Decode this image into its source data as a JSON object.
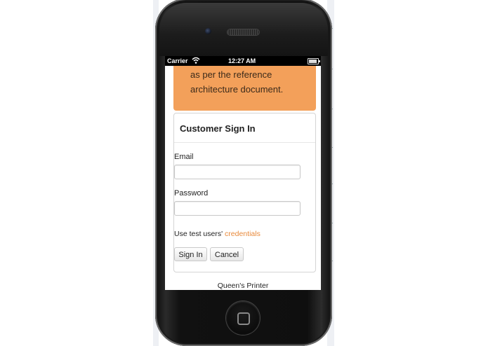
{
  "status_bar": {
    "carrier": "Carrier",
    "time": "12:27 AM"
  },
  "banner": {
    "lines": [
      "as per the reference",
      "architecture document."
    ]
  },
  "signin": {
    "title": "Customer Sign In",
    "email_label": "Email",
    "email_value": "",
    "password_label": "Password",
    "password_value": "",
    "hint_text": "Use test users'",
    "hint_link": "credentials",
    "sign_in_label": "Sign In",
    "cancel_label": "Cancel"
  },
  "footer": {
    "text": "Queen's Printer"
  },
  "colors": {
    "banner": "#f3a05a",
    "link": "#e8893a"
  }
}
